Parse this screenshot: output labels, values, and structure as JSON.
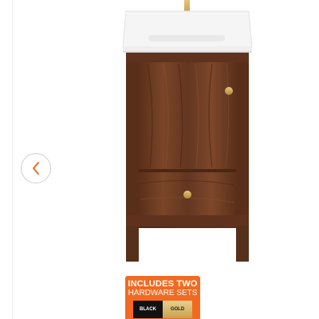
{
  "gallery": {
    "prev_icon": "chevron-left-icon",
    "prev_label": "Previous image"
  },
  "badge": {
    "line1": "INCLUDES TWO",
    "line2": "HARDWARE SETS",
    "options": [
      "BLACK",
      "GOLD"
    ]
  },
  "colors": {
    "badge_orange": "#f26a21",
    "walnut": "#6b3a22",
    "brass": "#c9a24e",
    "counter_white": "#f4f4f4"
  }
}
